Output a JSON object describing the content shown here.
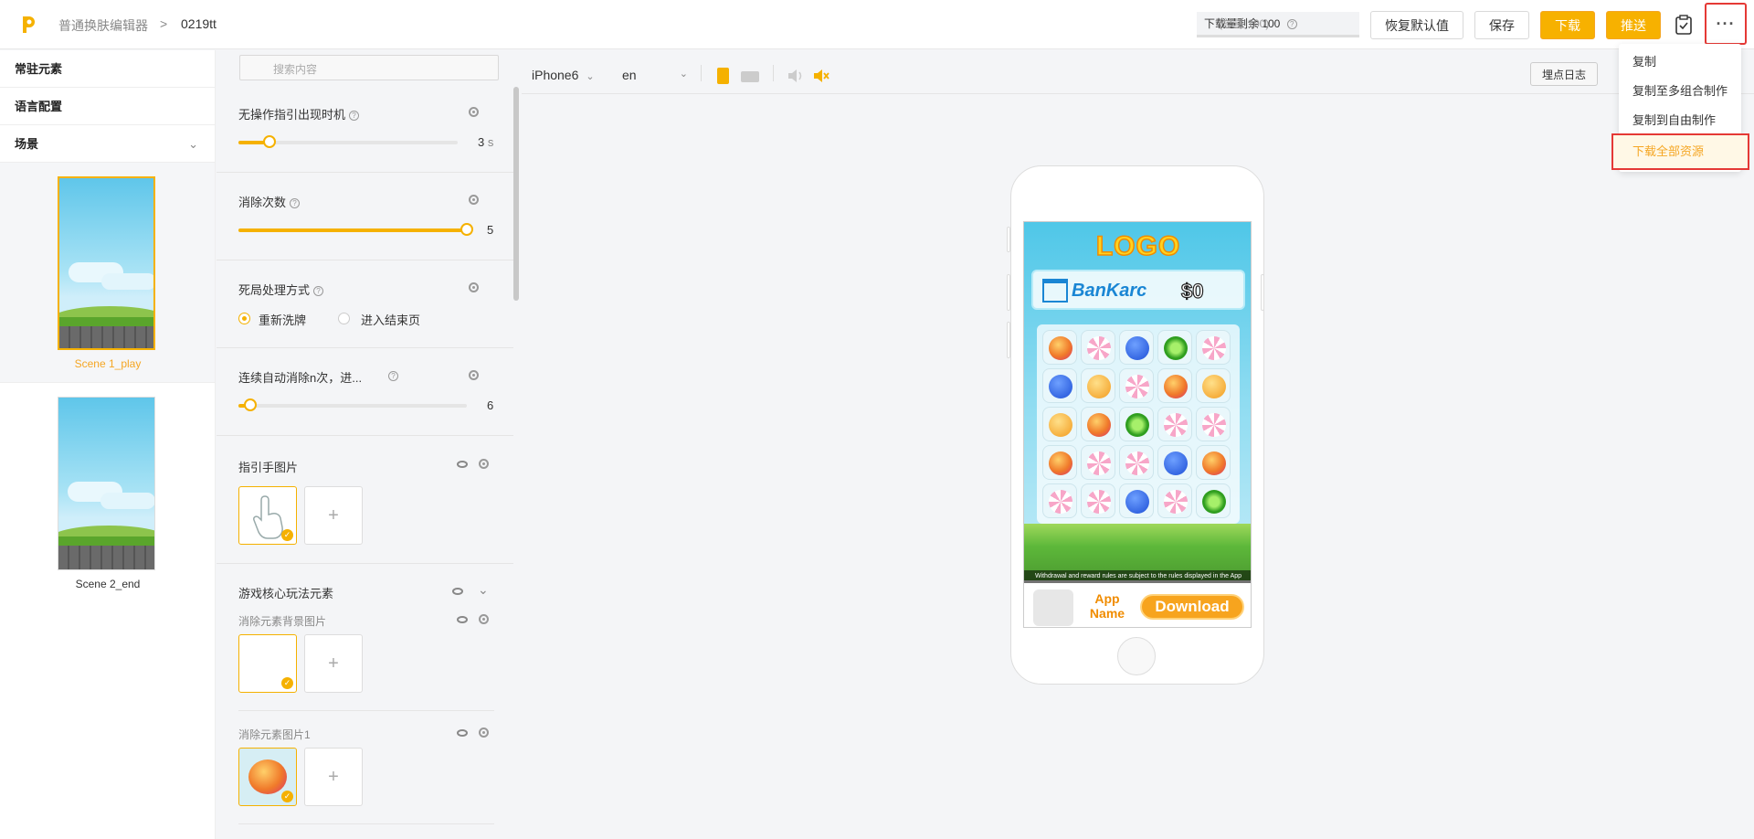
{
  "header": {
    "breadcrumb_root": "普通换肤编辑器",
    "breadcrumb_sep": ">",
    "breadcrumb_current": "0219tt",
    "quota_main": "下载量剩余 100",
    "quota_sub": "(总量 100)",
    "reset_label": "恢复默认值",
    "save_label": "保存",
    "download_label": "下载",
    "push_label": "推送",
    "more_label": "···"
  },
  "menu": {
    "items": [
      "复制",
      "复制至多组合制作",
      "复制到自由制作",
      "下载全部资源"
    ]
  },
  "left": {
    "items": [
      "常驻元素",
      "语言配置",
      "场景"
    ],
    "scenes": [
      "Scene 1_play",
      "Scene 2_end"
    ]
  },
  "props": {
    "search_placeholder": "搜索内容",
    "s1_title": "无操作指引出现时机",
    "s1_value": "3",
    "s1_unit": "s",
    "s1_level": 0.14,
    "s2_title": "消除次数",
    "s2_value": "5",
    "s2_level": 1.0,
    "s3_title": "死局处理方式",
    "s3_opt1": "重新洗牌",
    "s3_opt2": "进入结束页",
    "s4_title": "连续自动消除n次，进...",
    "s4_value": "6",
    "s4_level": 0.05,
    "s5_title": "指引手图片",
    "s6_title": "游戏核心玩法元素",
    "s6_sub1": "消除元素背景图片",
    "s6_sub2": "消除元素图片1",
    "add_symbol": "+"
  },
  "stage": {
    "device": "iPhone6",
    "lang": "en",
    "log_label": "埋点日志"
  },
  "preview": {
    "logo": "LOGO",
    "bank_name": "BanKarc",
    "bank_amount": "$0",
    "note": "Withdrawal and reward rules are subject to the rules displayed in the App",
    "app_name": "App Name",
    "download": "Download"
  },
  "colors": {
    "accent": "#f5b100",
    "highlight_border": "#e53935"
  }
}
